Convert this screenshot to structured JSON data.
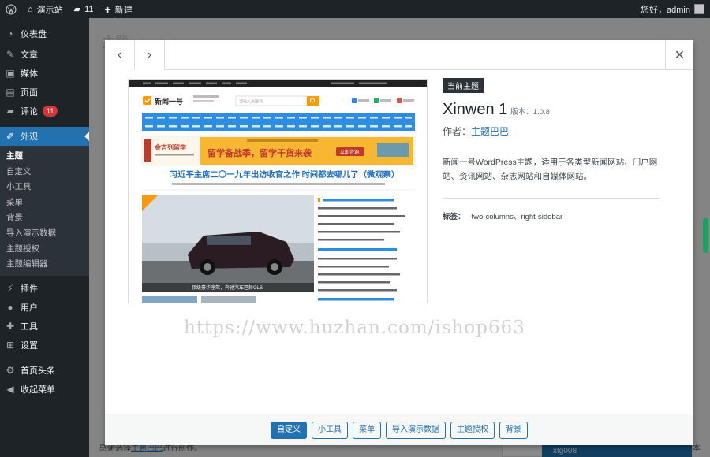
{
  "adminbar": {
    "site_name": "演示站",
    "comments_count": "11",
    "new_label": "新建",
    "greeting": "您好，admin"
  },
  "sidebar": {
    "items": [
      {
        "label": "仪表盘",
        "icon": "dashboard-icon"
      },
      {
        "label": "文章",
        "icon": "pin-icon"
      },
      {
        "label": "媒体",
        "icon": "media-icon"
      },
      {
        "label": "页面",
        "icon": "page-icon"
      },
      {
        "label": "评论",
        "icon": "comment-icon",
        "badge": "11"
      },
      {
        "label": "外观",
        "icon": "paintbrush-icon"
      }
    ],
    "submenu": [
      "主题",
      "自定义",
      "小工具",
      "菜单",
      "背景",
      "导入演示数据",
      "主题授权",
      "主题编辑器"
    ],
    "items_after": [
      {
        "label": "插件",
        "icon": "plugin-icon"
      },
      {
        "label": "用户",
        "icon": "user-icon"
      },
      {
        "label": "工具",
        "icon": "wrench-icon"
      },
      {
        "label": "设置",
        "icon": "settings-icon"
      },
      {
        "label": "首页头条",
        "icon": "gear-icon"
      },
      {
        "label": "收起菜单",
        "icon": "collapse-icon"
      }
    ]
  },
  "background": {
    "title": "主题",
    "footer_prefix": "感谢选择",
    "footer_link": "主题巴巴",
    "footer_suffix": "进行创作。",
    "version": "5.8.2版本",
    "card_text": "xtg008"
  },
  "theme": {
    "current_label": "当前主题",
    "name": "Xinwen 1",
    "version_label": "版本：1.0.8",
    "author_label": "作者：",
    "author": "主题巴巴",
    "description": "新闻一号WordPress主题，适用于各类型新闻网站、门户网站、资讯网站、杂志网站和自媒体网站。",
    "tags_label": "标签：",
    "tags": "two-columns、right-sidebar"
  },
  "preview": {
    "logo": "新闻一号",
    "search_placeholder": "请输入关键词",
    "headline": "习近平主席二〇一九年出访收官之作 时间都去哪儿了（微观察）",
    "ad_brand": "金吉列留学",
    "ad_text": "留学备战季，留学干货来袭",
    "ad_button": "立即咨询",
    "photo_caption": "顶级豪华座驾，奔驰汽车巴赫GLS"
  },
  "watermark": "https://www.huzhan.com/ishop663",
  "footer_buttons": [
    "自定义",
    "小工具",
    "菜单",
    "导入演示数据",
    "主题授权",
    "背景"
  ],
  "colors": {
    "accent": "#2271b1",
    "adminbar": "#1d2327",
    "preview_orange": "#f39c12",
    "preview_blue": "#2e8de0"
  }
}
